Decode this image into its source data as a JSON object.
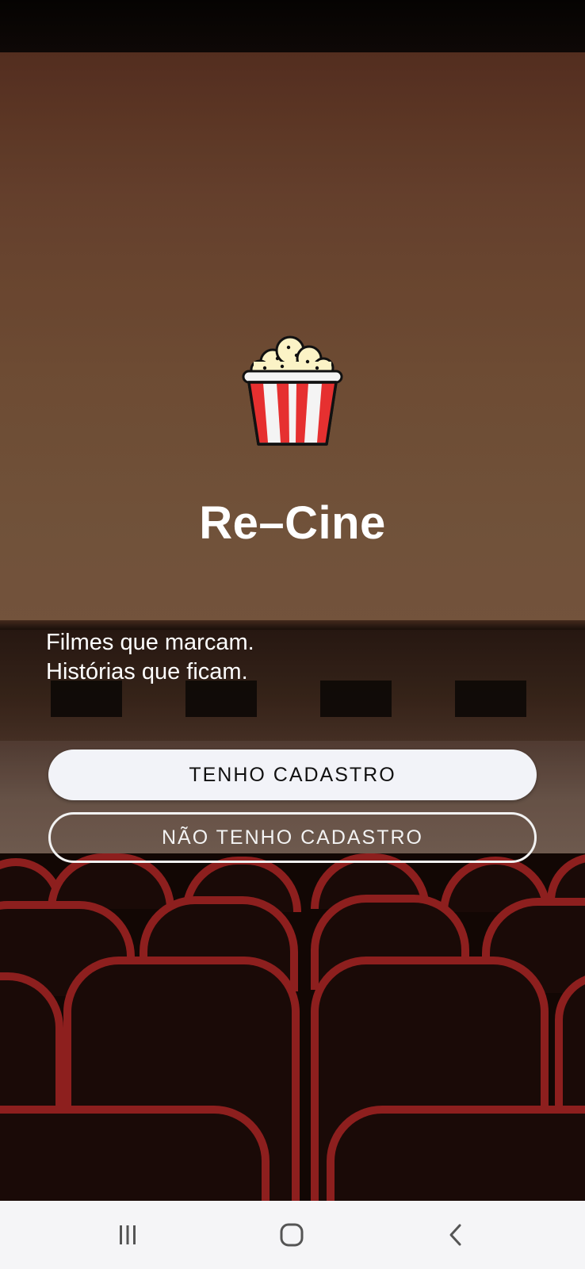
{
  "app": {
    "title": "Re–Cine",
    "tagline_line1": "Filmes que marcam.",
    "tagline_line2": "Histórias que ficam."
  },
  "actions": {
    "login_label": "TENHO CADASTRO",
    "signup_label": "NÃO TENHO CADASTRO"
  },
  "icons": {
    "logo": "popcorn-icon",
    "nav_recents": "recents-icon",
    "nav_home": "home-icon",
    "nav_back": "back-icon"
  },
  "colors": {
    "popcorn_red": "#e63030",
    "seat_red": "#9a2221",
    "primary_button_bg": "#f2f3f8",
    "nav_bar_bg": "#f5f5f7"
  }
}
